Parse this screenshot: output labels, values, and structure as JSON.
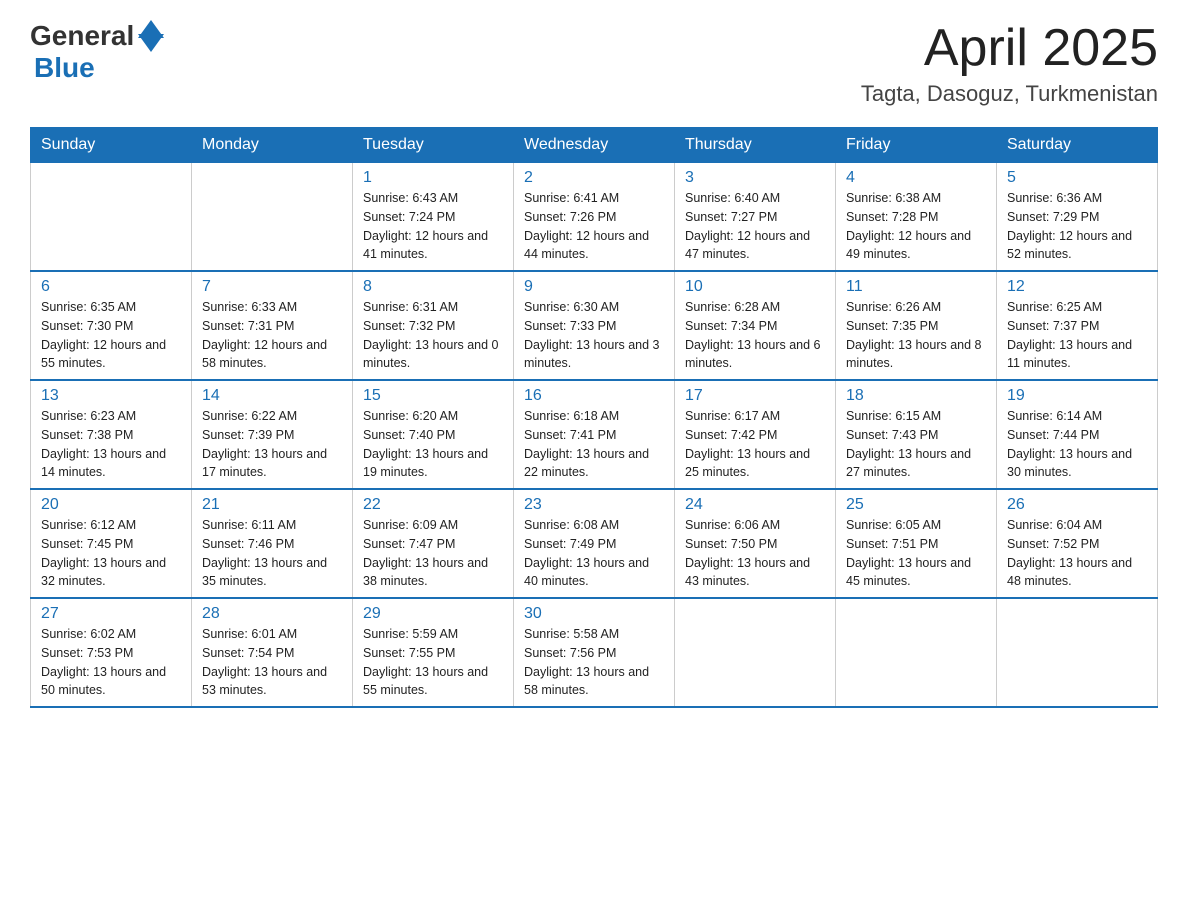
{
  "header": {
    "logo_general": "General",
    "logo_blue": "Blue",
    "month_year": "April 2025",
    "location": "Tagta, Dasoguz, Turkmenistan"
  },
  "weekdays": [
    "Sunday",
    "Monday",
    "Tuesday",
    "Wednesday",
    "Thursday",
    "Friday",
    "Saturday"
  ],
  "weeks": [
    [
      {
        "day": "",
        "sunrise": "",
        "sunset": "",
        "daylight": ""
      },
      {
        "day": "",
        "sunrise": "",
        "sunset": "",
        "daylight": ""
      },
      {
        "day": "1",
        "sunrise": "Sunrise: 6:43 AM",
        "sunset": "Sunset: 7:24 PM",
        "daylight": "Daylight: 12 hours and 41 minutes."
      },
      {
        "day": "2",
        "sunrise": "Sunrise: 6:41 AM",
        "sunset": "Sunset: 7:26 PM",
        "daylight": "Daylight: 12 hours and 44 minutes."
      },
      {
        "day": "3",
        "sunrise": "Sunrise: 6:40 AM",
        "sunset": "Sunset: 7:27 PM",
        "daylight": "Daylight: 12 hours and 47 minutes."
      },
      {
        "day": "4",
        "sunrise": "Sunrise: 6:38 AM",
        "sunset": "Sunset: 7:28 PM",
        "daylight": "Daylight: 12 hours and 49 minutes."
      },
      {
        "day": "5",
        "sunrise": "Sunrise: 6:36 AM",
        "sunset": "Sunset: 7:29 PM",
        "daylight": "Daylight: 12 hours and 52 minutes."
      }
    ],
    [
      {
        "day": "6",
        "sunrise": "Sunrise: 6:35 AM",
        "sunset": "Sunset: 7:30 PM",
        "daylight": "Daylight: 12 hours and 55 minutes."
      },
      {
        "day": "7",
        "sunrise": "Sunrise: 6:33 AM",
        "sunset": "Sunset: 7:31 PM",
        "daylight": "Daylight: 12 hours and 58 minutes."
      },
      {
        "day": "8",
        "sunrise": "Sunrise: 6:31 AM",
        "sunset": "Sunset: 7:32 PM",
        "daylight": "Daylight: 13 hours and 0 minutes."
      },
      {
        "day": "9",
        "sunrise": "Sunrise: 6:30 AM",
        "sunset": "Sunset: 7:33 PM",
        "daylight": "Daylight: 13 hours and 3 minutes."
      },
      {
        "day": "10",
        "sunrise": "Sunrise: 6:28 AM",
        "sunset": "Sunset: 7:34 PM",
        "daylight": "Daylight: 13 hours and 6 minutes."
      },
      {
        "day": "11",
        "sunrise": "Sunrise: 6:26 AM",
        "sunset": "Sunset: 7:35 PM",
        "daylight": "Daylight: 13 hours and 8 minutes."
      },
      {
        "day": "12",
        "sunrise": "Sunrise: 6:25 AM",
        "sunset": "Sunset: 7:37 PM",
        "daylight": "Daylight: 13 hours and 11 minutes."
      }
    ],
    [
      {
        "day": "13",
        "sunrise": "Sunrise: 6:23 AM",
        "sunset": "Sunset: 7:38 PM",
        "daylight": "Daylight: 13 hours and 14 minutes."
      },
      {
        "day": "14",
        "sunrise": "Sunrise: 6:22 AM",
        "sunset": "Sunset: 7:39 PM",
        "daylight": "Daylight: 13 hours and 17 minutes."
      },
      {
        "day": "15",
        "sunrise": "Sunrise: 6:20 AM",
        "sunset": "Sunset: 7:40 PM",
        "daylight": "Daylight: 13 hours and 19 minutes."
      },
      {
        "day": "16",
        "sunrise": "Sunrise: 6:18 AM",
        "sunset": "Sunset: 7:41 PM",
        "daylight": "Daylight: 13 hours and 22 minutes."
      },
      {
        "day": "17",
        "sunrise": "Sunrise: 6:17 AM",
        "sunset": "Sunset: 7:42 PM",
        "daylight": "Daylight: 13 hours and 25 minutes."
      },
      {
        "day": "18",
        "sunrise": "Sunrise: 6:15 AM",
        "sunset": "Sunset: 7:43 PM",
        "daylight": "Daylight: 13 hours and 27 minutes."
      },
      {
        "day": "19",
        "sunrise": "Sunrise: 6:14 AM",
        "sunset": "Sunset: 7:44 PM",
        "daylight": "Daylight: 13 hours and 30 minutes."
      }
    ],
    [
      {
        "day": "20",
        "sunrise": "Sunrise: 6:12 AM",
        "sunset": "Sunset: 7:45 PM",
        "daylight": "Daylight: 13 hours and 32 minutes."
      },
      {
        "day": "21",
        "sunrise": "Sunrise: 6:11 AM",
        "sunset": "Sunset: 7:46 PM",
        "daylight": "Daylight: 13 hours and 35 minutes."
      },
      {
        "day": "22",
        "sunrise": "Sunrise: 6:09 AM",
        "sunset": "Sunset: 7:47 PM",
        "daylight": "Daylight: 13 hours and 38 minutes."
      },
      {
        "day": "23",
        "sunrise": "Sunrise: 6:08 AM",
        "sunset": "Sunset: 7:49 PM",
        "daylight": "Daylight: 13 hours and 40 minutes."
      },
      {
        "day": "24",
        "sunrise": "Sunrise: 6:06 AM",
        "sunset": "Sunset: 7:50 PM",
        "daylight": "Daylight: 13 hours and 43 minutes."
      },
      {
        "day": "25",
        "sunrise": "Sunrise: 6:05 AM",
        "sunset": "Sunset: 7:51 PM",
        "daylight": "Daylight: 13 hours and 45 minutes."
      },
      {
        "day": "26",
        "sunrise": "Sunrise: 6:04 AM",
        "sunset": "Sunset: 7:52 PM",
        "daylight": "Daylight: 13 hours and 48 minutes."
      }
    ],
    [
      {
        "day": "27",
        "sunrise": "Sunrise: 6:02 AM",
        "sunset": "Sunset: 7:53 PM",
        "daylight": "Daylight: 13 hours and 50 minutes."
      },
      {
        "day": "28",
        "sunrise": "Sunrise: 6:01 AM",
        "sunset": "Sunset: 7:54 PM",
        "daylight": "Daylight: 13 hours and 53 minutes."
      },
      {
        "day": "29",
        "sunrise": "Sunrise: 5:59 AM",
        "sunset": "Sunset: 7:55 PM",
        "daylight": "Daylight: 13 hours and 55 minutes."
      },
      {
        "day": "30",
        "sunrise": "Sunrise: 5:58 AM",
        "sunset": "Sunset: 7:56 PM",
        "daylight": "Daylight: 13 hours and 58 minutes."
      },
      {
        "day": "",
        "sunrise": "",
        "sunset": "",
        "daylight": ""
      },
      {
        "day": "",
        "sunrise": "",
        "sunset": "",
        "daylight": ""
      },
      {
        "day": "",
        "sunrise": "",
        "sunset": "",
        "daylight": ""
      }
    ]
  ]
}
